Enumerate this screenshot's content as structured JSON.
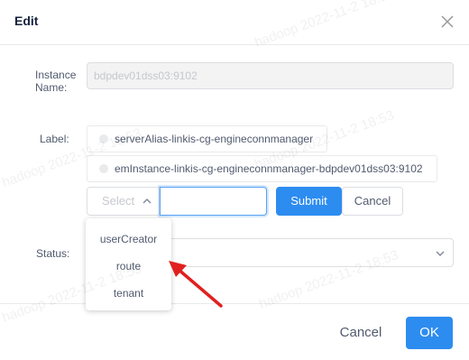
{
  "dialog": {
    "title": "Edit",
    "close_icon": "close-icon"
  },
  "form": {
    "instance_label_line1": "Instance",
    "instance_label_line2": "Name:",
    "instance_value": "bdpdev01dss03:9102",
    "label_label": "Label:",
    "tags": [
      "serverAlias-linkis-cg-engineconnmanager",
      "emInstance-linkis-cg-engineconnmanager-bdpdev01dss03:9102"
    ],
    "select_placeholder": "Select",
    "input_value": "",
    "submit_label": "Submit",
    "cancel_label": "Cancel",
    "status_label": "Status:"
  },
  "dropdown": {
    "options": [
      "userCreator",
      "route",
      "tenant"
    ]
  },
  "footer": {
    "cancel_label": "Cancel",
    "ok_label": "OK"
  },
  "watermark": {
    "text": "hadoop 2022-11-2 18:53"
  },
  "colors": {
    "primary": "#2d8cf0",
    "annotation_arrow": "#e02020"
  }
}
